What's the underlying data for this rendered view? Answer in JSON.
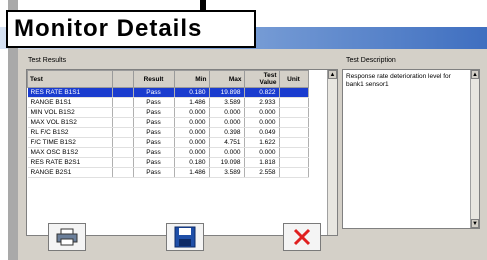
{
  "callout": {
    "title": "Monitor Details"
  },
  "sections": {
    "results_title": "Test Results",
    "description_title": "Test Description"
  },
  "table": {
    "headers": [
      "Test",
      "",
      "Result",
      "Min",
      "Max",
      "Test Value",
      "Unit"
    ],
    "rows": [
      [
        "RES RATE B1S1",
        "",
        "Pass",
        "0.180",
        "19.898",
        "0.822",
        ""
      ],
      [
        "RANGE B1S1",
        "",
        "Pass",
        "1.486",
        "3.589",
        "2.933",
        ""
      ],
      [
        "MIN VOL B1S2",
        "",
        "Pass",
        "0.000",
        "0.000",
        "0.000",
        ""
      ],
      [
        "MAX VOL B1S2",
        "",
        "Pass",
        "0.000",
        "0.000",
        "0.000",
        ""
      ],
      [
        "RL F/C B1S2",
        "",
        "Pass",
        "0.000",
        "0.398",
        "0.049",
        ""
      ],
      [
        "F/C TIME B1S2",
        "",
        "Pass",
        "0.000",
        "4.751",
        "1.622",
        ""
      ],
      [
        "MAX OSC B1S2",
        "",
        "Pass",
        "0.000",
        "0.000",
        "0.000",
        ""
      ],
      [
        "RES RATE B2S1",
        "",
        "Pass",
        "0.180",
        "19.098",
        "1.818",
        ""
      ],
      [
        "RANGE B2S1",
        "",
        "Pass",
        "1.486",
        "3.589",
        "2.558",
        ""
      ]
    ],
    "selected_row": 0
  },
  "description": {
    "text": "Response rate deterioration level for bank1 sensor1"
  },
  "buttons": {
    "print": "printer-icon",
    "save": "floppy-disk-icon",
    "close": "red-x-icon"
  },
  "colors": {
    "selection": "#1a3ccf",
    "close_x": "#e02020",
    "floppy": "#1f4fa8"
  }
}
